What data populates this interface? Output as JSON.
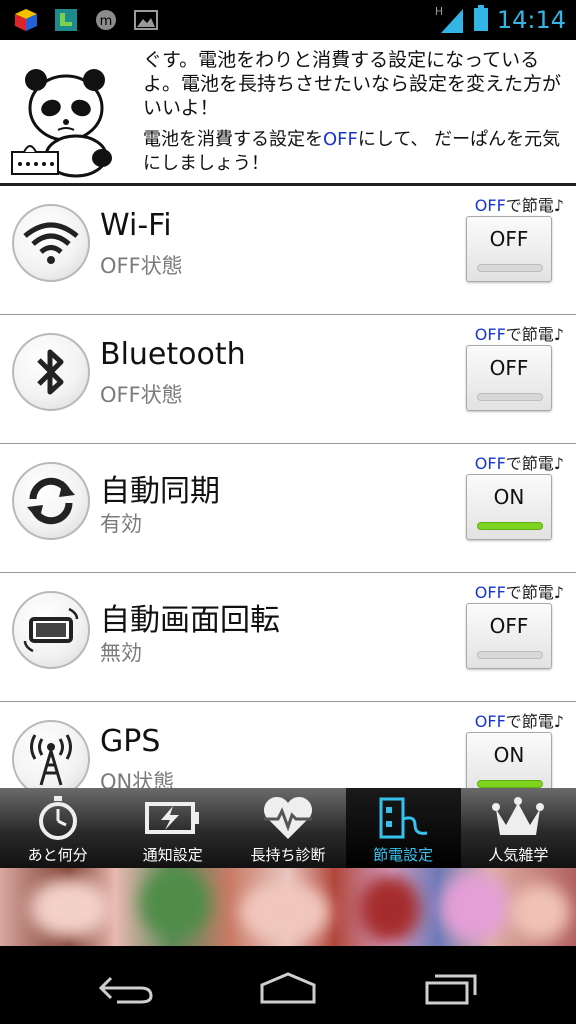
{
  "status_bar": {
    "time": "14:14",
    "network": "H",
    "icons": [
      "cube-icon",
      "app-l-icon",
      "messenger-icon",
      "image-icon"
    ]
  },
  "header": {
    "message_1": "ぐす。電池をわりと消費する設定になっているよ。電池を長持ちさせたいなら設定を変えた方がいいよ！",
    "message_2_pre": "電池を消費する設定を",
    "message_2_off": "OFF",
    "message_2_post": "にして、 だーぱんを元気にしましょう！"
  },
  "hint": {
    "off": "OFF",
    "rest": "で節電♪"
  },
  "settings": [
    {
      "title": "Wi-Fi",
      "status": "OFF状態",
      "toggle": "OFF",
      "on": false,
      "icon": "wifi-icon"
    },
    {
      "title": "Bluetooth",
      "status": "OFF状態",
      "toggle": "OFF",
      "on": false,
      "icon": "bluetooth-icon"
    },
    {
      "title": "自動同期",
      "status": "有効",
      "toggle": "ON",
      "on": true,
      "icon": "sync-icon"
    },
    {
      "title": "自動画面回転",
      "status": "無効",
      "toggle": "OFF",
      "on": false,
      "icon": "screen-rotation-icon"
    },
    {
      "title": "GPS",
      "status": "ON状態",
      "toggle": "ON",
      "on": true,
      "icon": "gps-tower-icon"
    }
  ],
  "tabs": [
    {
      "label": "あと何分",
      "icon": "stopwatch-icon"
    },
    {
      "label": "通知設定",
      "icon": "battery-charge-icon"
    },
    {
      "label": "長持ち診断",
      "icon": "heart-pulse-icon"
    },
    {
      "label": "節電設定",
      "icon": "power-plug-icon",
      "active": true
    },
    {
      "label": "人気雑学",
      "icon": "crown-icon"
    }
  ],
  "colors": {
    "accent": "#33b5e5",
    "toggle_on": "#7fd321",
    "highlight_blue": "#1a35d6"
  }
}
